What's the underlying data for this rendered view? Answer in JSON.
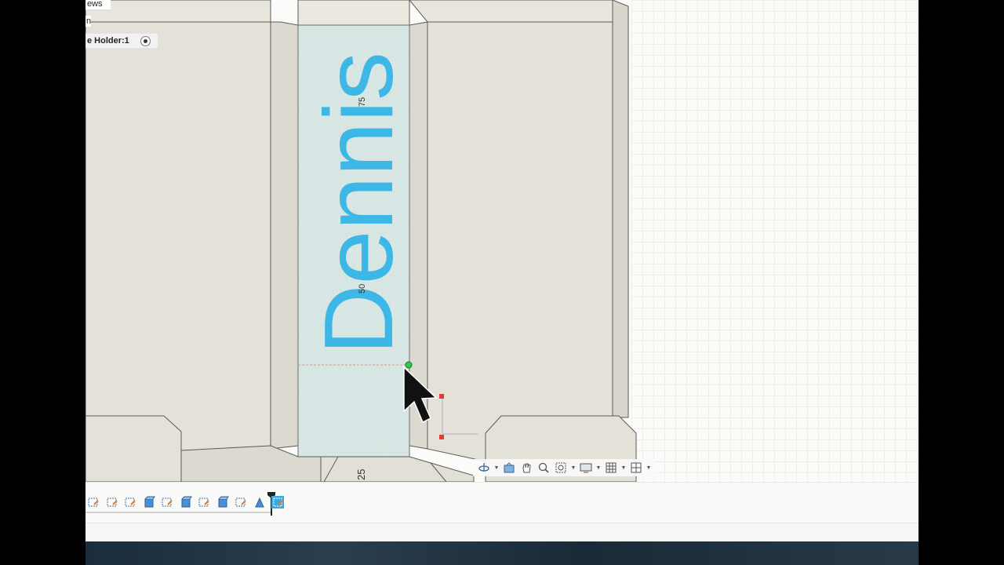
{
  "browser": {
    "views_fragment": "ews",
    "n_fragment": "n",
    "component_label": "e Holder:1"
  },
  "sketch": {
    "text": "Dennis",
    "text_color": "#3db8e6",
    "dimensions": {
      "upper": "75",
      "middle": "50",
      "lower": "25"
    }
  },
  "nav_toolbar": {
    "items": [
      "orbit-icon",
      "look-at-icon",
      "pan-icon",
      "zoom-icon",
      "fit-icon",
      "display-settings-icon",
      "grid-icon",
      "viewports-icon"
    ]
  },
  "timeline": {
    "features": [
      "sketch",
      "sketch",
      "sketch",
      "extrude",
      "sketch",
      "extrude",
      "sketch",
      "extrude",
      "sketch",
      "fillet",
      "sketch-active"
    ]
  },
  "colors": {
    "model_face": "#e4e1d8",
    "model_edge": "#5a5a56",
    "sketch_region": "#d8e6e4",
    "accent": "#3db8e6"
  }
}
